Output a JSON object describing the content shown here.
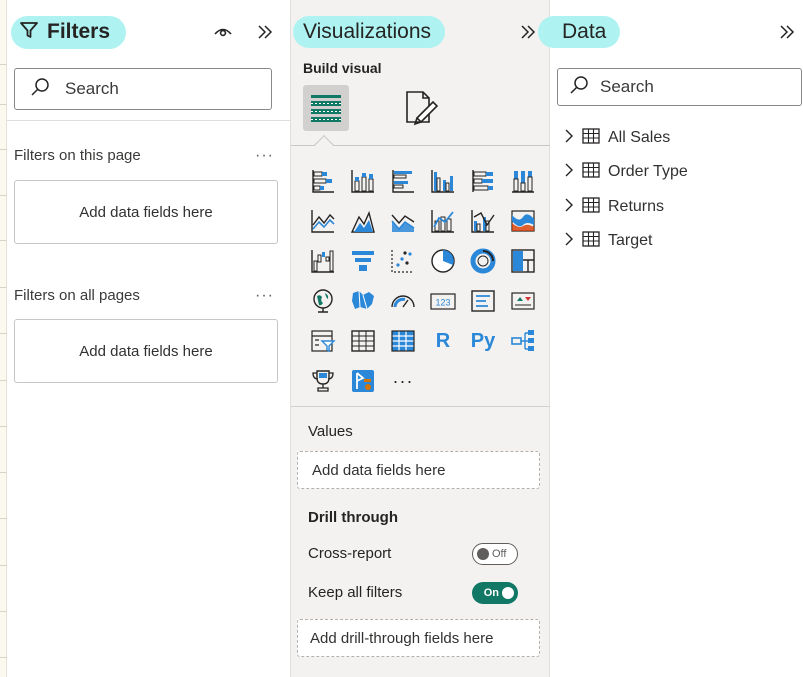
{
  "filters": {
    "title": "Filters",
    "search_placeholder": "Search",
    "this_page_label": "Filters on this page",
    "this_page_drop": "Add data fields here",
    "all_pages_label": "Filters on all pages",
    "all_pages_drop": "Add data fields here",
    "more": "···"
  },
  "visualizations": {
    "title": "Visualizations",
    "build_visual": "Build visual",
    "gallery": [
      "stacked-bar-chart-icon",
      "stacked-column-chart-icon",
      "clustered-bar-chart-icon",
      "clustered-column-chart-icon",
      "100-stacked-bar-chart-icon",
      "100-stacked-column-chart-icon",
      "line-chart-icon",
      "area-chart-icon",
      "stacked-area-chart-icon",
      "line-and-stacked-column-chart-icon",
      "line-and-clustered-column-chart-icon",
      "ribbon-chart-icon",
      "waterfall-chart-icon",
      "funnel-chart-icon",
      "scatter-chart-icon",
      "pie-chart-icon",
      "donut-chart-icon",
      "treemap-icon",
      "map-icon",
      "filled-map-icon",
      "gauge-icon",
      "card-icon",
      "multi-row-card-icon",
      "kpi-icon",
      "slicer-icon",
      "table-icon",
      "matrix-icon",
      "r-script-visual-icon",
      "python-visual-icon",
      "key-influencers-icon",
      "trophy-icon",
      "power-apps-icon",
      "more-visuals-icon"
    ],
    "r_label": "R",
    "py_label": "Py",
    "more_label": "···",
    "values_label": "Values",
    "values_drop": "Add data fields here",
    "drill_through": "Drill through",
    "cross_report": "Cross-report",
    "cross_report_state": "Off",
    "keep_all_filters": "Keep all filters",
    "keep_all_filters_state": "On",
    "drill_drop": "Add drill-through fields here"
  },
  "data_pane": {
    "title": "Data",
    "search_placeholder": "Search",
    "tables": [
      "All Sales",
      "Order Type",
      "Returns",
      "Target"
    ]
  },
  "colors": {
    "highlight": "#aef3f1",
    "toggle_on": "#117865",
    "icon_blue": "#2b88d8",
    "icon_dark": "#252423"
  }
}
